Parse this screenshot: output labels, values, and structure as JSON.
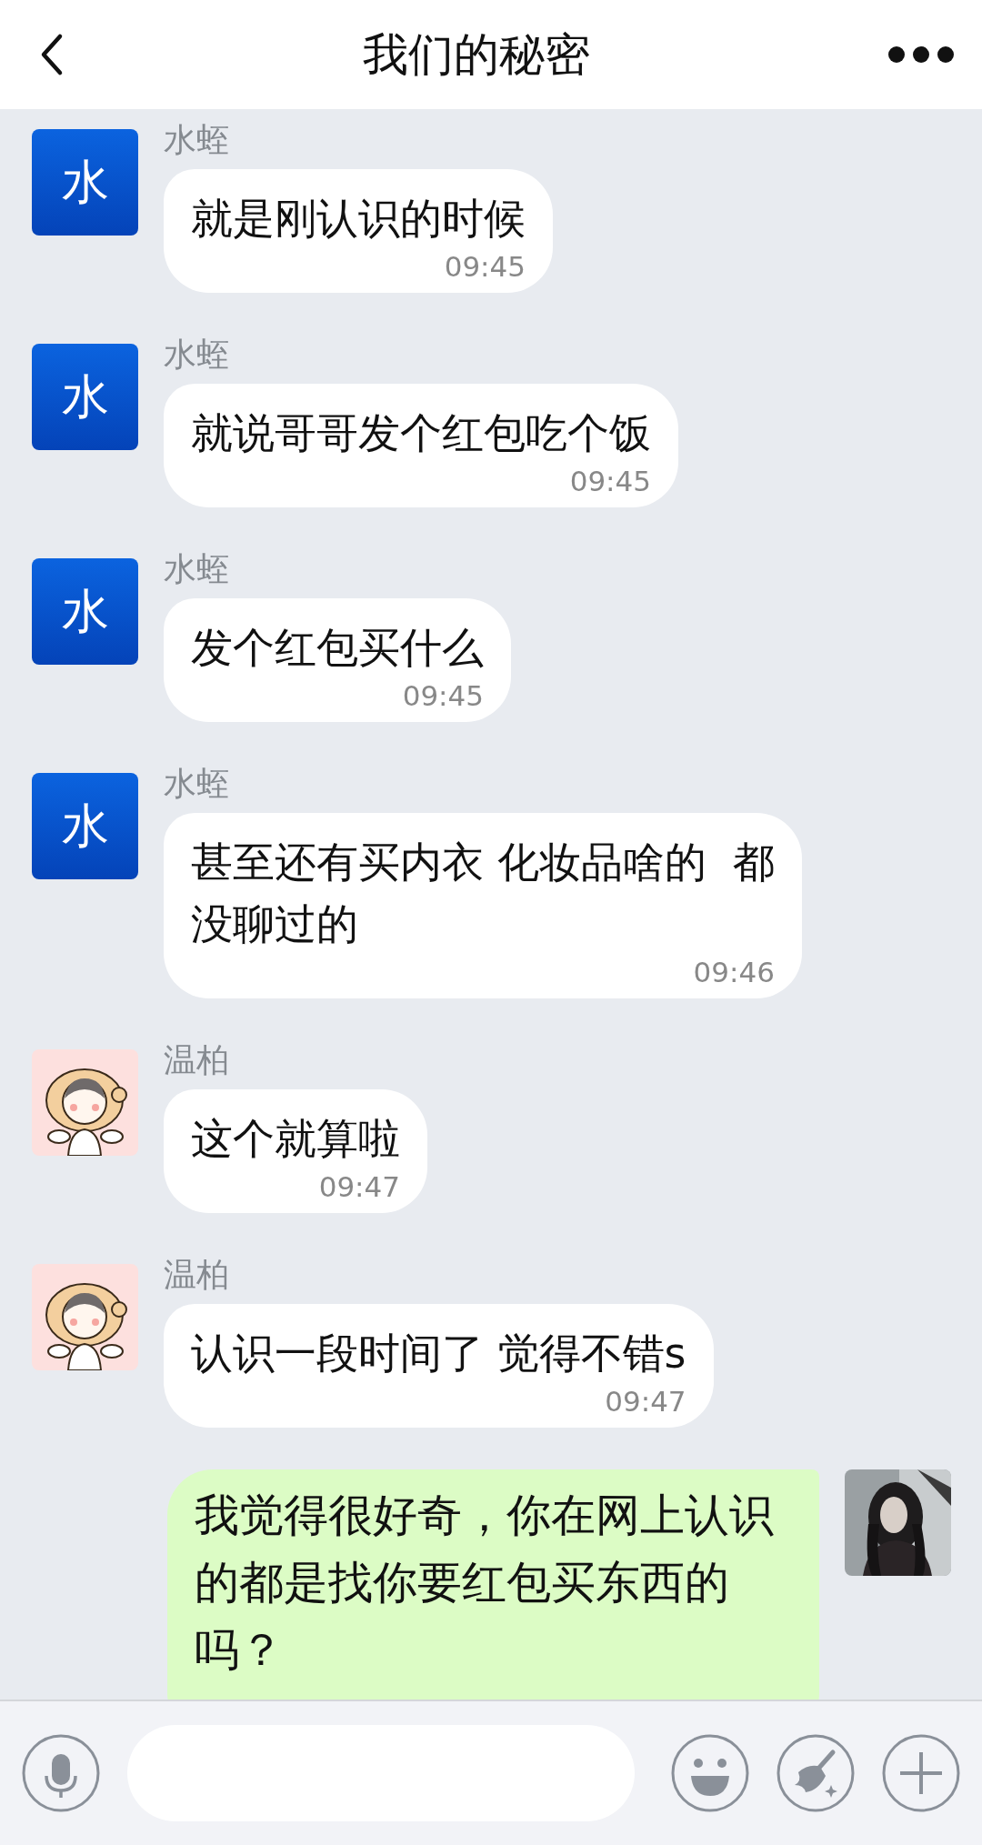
{
  "header": {
    "title": "我们的秘密"
  },
  "messages": [
    {
      "kind": "incoming",
      "sender": "水蛭",
      "avatar": {
        "kind": "letter",
        "text": "水"
      },
      "lines": [
        "就是刚认识的时候"
      ],
      "time": "09:45"
    },
    {
      "kind": "incoming",
      "sender": "水蛭",
      "avatar": {
        "kind": "letter",
        "text": "水"
      },
      "lines": [
        "就说哥哥发个红包吃个饭"
      ],
      "time": "09:45"
    },
    {
      "kind": "incoming",
      "sender": "水蛭",
      "avatar": {
        "kind": "letter",
        "text": "水"
      },
      "lines": [
        "发个红包买什么"
      ],
      "time": "09:45"
    },
    {
      "kind": "incoming",
      "sender": "水蛭",
      "avatar": {
        "kind": "letter",
        "text": "水"
      },
      "lines": [
        "甚至还有买内衣 化妆品啥的  都",
        "没聊过的"
      ],
      "time": "09:46"
    },
    {
      "kind": "incoming",
      "sender": "温柏",
      "avatar": {
        "kind": "picture"
      },
      "lines": [
        "这个就算啦"
      ],
      "time": "09:47"
    },
    {
      "kind": "incoming",
      "sender": "温柏",
      "avatar": {
        "kind": "picture"
      },
      "lines": [
        "认识一段时间了 觉得不错s"
      ],
      "time": "09:47"
    },
    {
      "kind": "outgoing",
      "avatar": {
        "kind": "picture"
      },
      "lines": [
        "我觉得很好奇，你在网上认识",
        "的都是找你要红包买东西的",
        "吗？"
      ]
    }
  ]
}
